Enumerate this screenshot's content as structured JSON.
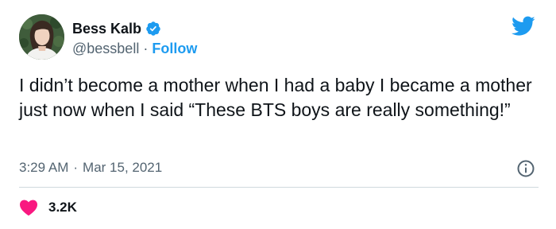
{
  "author": {
    "display_name": "Bess Kalb",
    "handle": "@bessbell",
    "separator": "·",
    "follow_label": "Follow"
  },
  "tweet": {
    "text": "I didn’t become a mother when I had a baby I became a mother just now when I said “These BTS boys are really something!”",
    "time": "3:29 AM",
    "separator": "·",
    "date": "Mar 15, 2021",
    "like_count": "3.2K"
  },
  "icons": {
    "verified": "verified-badge-icon",
    "brand": "twitter-bird-icon",
    "info": "info-icon",
    "like": "heart-icon"
  },
  "colors": {
    "accent": "#1d9bf0",
    "like": "#f91880",
    "text": "#0f1419",
    "secondary": "#536471",
    "divider": "#cfd9de"
  }
}
